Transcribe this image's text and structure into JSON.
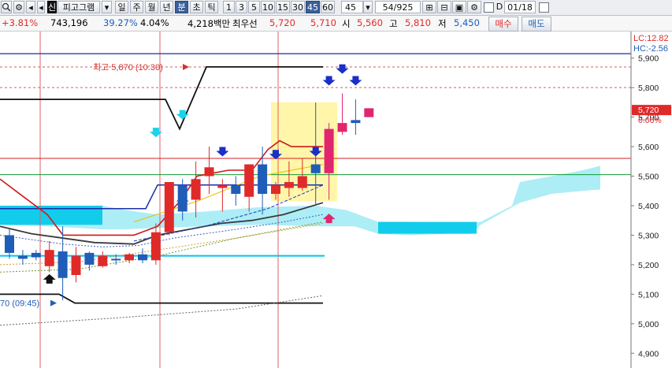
{
  "toolbar": {
    "chart_type": "피고그램",
    "period_buttons": [
      "일",
      "주",
      "월",
      "년",
      "분",
      "초",
      "틱"
    ],
    "selected_period": "분",
    "minute_buttons": [
      "1",
      "3",
      "5",
      "10",
      "15",
      "30",
      "45",
      "60"
    ],
    "selected_minute": "45",
    "interval_value": "45",
    "page_counter": "54/925",
    "date_checkbox_label": "D",
    "date_value": "01/18"
  },
  "quote": {
    "change_rate": "+3.81%",
    "volume": "743,196",
    "turnover_rate": "39.27%",
    "volume_ratio": "4.04%",
    "trade_amount": "4,218백만",
    "preferred_label": "최우선",
    "ask": "5,720",
    "bid": "5,710",
    "open_label": "시",
    "open": "5,560",
    "high_label": "고",
    "high": "5,810",
    "low_label": "저",
    "low": "5,450",
    "buy_label": "매수",
    "sell_label": "매도"
  },
  "colors": {
    "up": "#e02a2a",
    "down": "#1f5db8",
    "magenta": "#e0266f",
    "cloud": "#9feaf5",
    "highlight": "#fff59a",
    "current_price_bg": "#e02a2a"
  },
  "chart_data": {
    "type": "candlestick",
    "price_axis": {
      "ticks": [
        4900,
        5000,
        5100,
        5200,
        5300,
        5400,
        5500,
        5600,
        5700,
        5800,
        5900
      ],
      "tick_labels": [
        "4,900",
        "5,000",
        "5,100",
        "5,200",
        "5,300",
        "5,400",
        "5,500",
        "5,600",
        "5,700",
        "5,800",
        "5,900"
      ],
      "ylim": [
        4850,
        5990
      ],
      "lc_label": "LC:12.82",
      "hc_label": "HC:-2.56",
      "current_price": "5,720",
      "current_change": "0.00%"
    },
    "annotations": {
      "high_marker": "최고 5,870 (10:30)",
      "low_marker": "70 (09:45)"
    },
    "candles": [
      {
        "o": 5300,
        "h": 5320,
        "c": 5240,
        "l": 5220
      },
      {
        "o": 5230,
        "h": 5250,
        "c": 5220,
        "l": 5200
      },
      {
        "o": 5240,
        "h": 5250,
        "c": 5225,
        "l": 5215
      },
      {
        "o": 5195,
        "h": 5280,
        "c": 5250,
        "l": 5175
      },
      {
        "o": 5245,
        "h": 5330,
        "c": 5155,
        "l": 5080
      },
      {
        "o": 5165,
        "h": 5260,
        "c": 5230,
        "l": 5140
      },
      {
        "o": 5240,
        "h": 5245,
        "c": 5200,
        "l": 5180
      },
      {
        "o": 5195,
        "h": 5245,
        "c": 5230,
        "l": 5190
      },
      {
        "o": 5220,
        "h": 5235,
        "c": 5215,
        "l": 5200
      },
      {
        "o": 5215,
        "h": 5240,
        "c": 5235,
        "l": 5205
      },
      {
        "o": 5235,
        "h": 5255,
        "c": 5215,
        "l": 5205
      },
      {
        "o": 5215,
        "h": 5340,
        "c": 5310,
        "l": 5200
      },
      {
        "o": 5310,
        "h": 5480,
        "c": 5480,
        "l": 5300
      },
      {
        "o": 5470,
        "h": 5490,
        "c": 5380,
        "l": 5350
      },
      {
        "o": 5420,
        "h": 5550,
        "c": 5490,
        "l": 5360
      },
      {
        "o": 5500,
        "h": 5600,
        "c": 5530,
        "l": 5440
      },
      {
        "o": 5460,
        "h": 5490,
        "c": 5470,
        "l": 5380
      },
      {
        "o": 5470,
        "h": 5500,
        "c": 5440,
        "l": 5400
      },
      {
        "o": 5430,
        "h": 5540,
        "c": 5540,
        "l": 5380
      },
      {
        "o": 5540,
        "h": 5600,
        "c": 5440,
        "l": 5370
      },
      {
        "o": 5440,
        "h": 5480,
        "c": 5470,
        "l": 5420
      },
      {
        "o": 5460,
        "h": 5550,
        "c": 5480,
        "l": 5430
      },
      {
        "o": 5460,
        "h": 5560,
        "c": 5500,
        "l": 5450
      },
      {
        "o": 5540,
        "h": 5750,
        "c": 5510,
        "l": 5400
      },
      {
        "o": 5510,
        "h": 5680,
        "c": 5660,
        "l": 5420
      },
      {
        "o": 5650,
        "h": 5780,
        "c": 5680,
        "l": 5640
      },
      {
        "o": 5690,
        "h": 5760,
        "c": 5680,
        "l": 5640
      },
      {
        "o": 5700,
        "h": 5730,
        "c": 5730,
        "l": 5700
      }
    ]
  }
}
